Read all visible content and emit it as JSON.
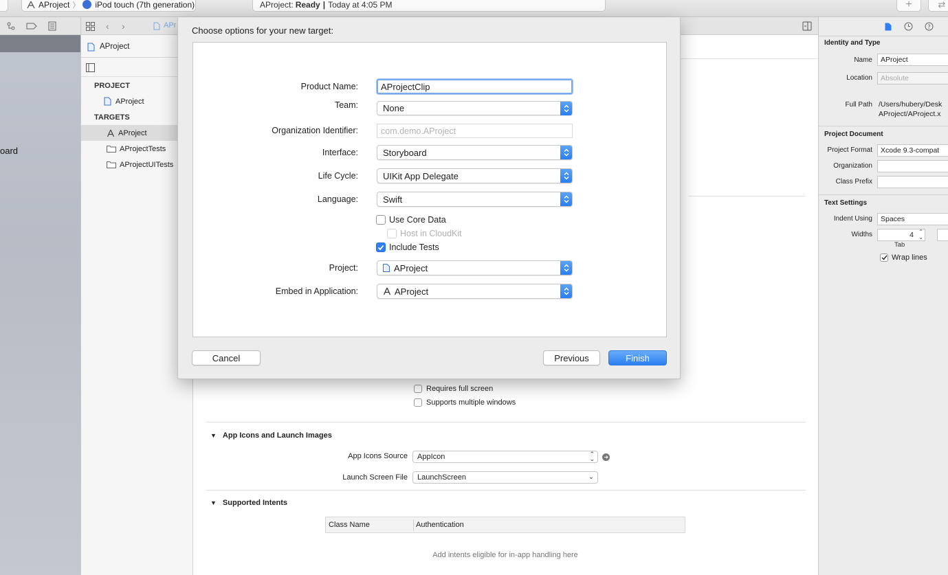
{
  "toolbar": {
    "scheme": "AProject",
    "device": "iPod touch (7th generation)",
    "status_project": "AProject:",
    "status_state": "Ready",
    "status_separator": "|",
    "status_time": "Today at 4:05 PM"
  },
  "desktop": {
    "partial_label": "oard"
  },
  "editor_tab": {
    "label": "APr"
  },
  "navigator": {
    "file_title": "AProject",
    "project_header": "PROJECT",
    "project_item": "AProject",
    "targets_header": "TARGETS",
    "targets": [
      "AProject",
      "AProjectTests",
      "AProjectUITests"
    ]
  },
  "sheet": {
    "title": "Choose options for your new target:",
    "fields": {
      "product_name": {
        "label": "Product Name:",
        "value": "AProjectClip"
      },
      "team": {
        "label": "Team:",
        "value": "None"
      },
      "org_id": {
        "label": "Organization Identifier:",
        "placeholder": "com.demo.AProject"
      },
      "interface": {
        "label": "Interface:",
        "value": "Storyboard"
      },
      "life_cycle": {
        "label": "Life Cycle:",
        "value": "UIKit App Delegate"
      },
      "language": {
        "label": "Language:",
        "value": "Swift"
      },
      "use_core_data": {
        "label": "Use Core Data",
        "checked": false
      },
      "host_in_cloudkit": {
        "label": "Host in CloudKit",
        "checked": false,
        "enabled": false
      },
      "include_tests": {
        "label": "Include Tests",
        "checked": true
      },
      "project": {
        "label": "Project:",
        "value": "AProject"
      },
      "embed": {
        "label": "Embed in Application:",
        "value": "AProject"
      }
    },
    "buttons": {
      "cancel": "Cancel",
      "previous": "Previous",
      "finish": "Finish"
    }
  },
  "editor": {
    "requires_full_screen": "Requires full screen",
    "supports_multiple_windows": "Supports multiple windows",
    "app_icons_section": "App Icons and Launch Images",
    "app_icons_source_label": "App Icons Source",
    "app_icons_source_value": "AppIcon",
    "launch_screen_label": "Launch Screen File",
    "launch_screen_value": "LaunchScreen",
    "supported_intents_section": "Supported Intents",
    "intents_columns": [
      "Class Name",
      "Authentication"
    ],
    "intents_empty": "Add intents eligible for in-app handling here"
  },
  "inspector": {
    "identity_header": "Identity and Type",
    "name_label": "Name",
    "name_value": "AProject",
    "location_label": "Location",
    "location_value": "Absolute",
    "full_path_label": "Full Path",
    "full_path_line1": "/Users/hubery/Desk",
    "full_path_line2": "AProject/AProject.x",
    "project_doc_header": "Project Document",
    "project_format_label": "Project Format",
    "project_format_value": "Xcode 9.3-compat",
    "organization_label": "Organization",
    "class_prefix_label": "Class Prefix",
    "text_settings_header": "Text Settings",
    "indent_using_label": "Indent Using",
    "indent_using_value": "Spaces",
    "widths_label": "Widths",
    "widths_tab_value": "4",
    "tab_caption": "Tab",
    "wrap_lines_label": "Wrap lines",
    "wrap_lines_checked": true
  },
  "colors": {
    "accent": "#2f7ff3",
    "sheet_bg": "#ececec"
  }
}
